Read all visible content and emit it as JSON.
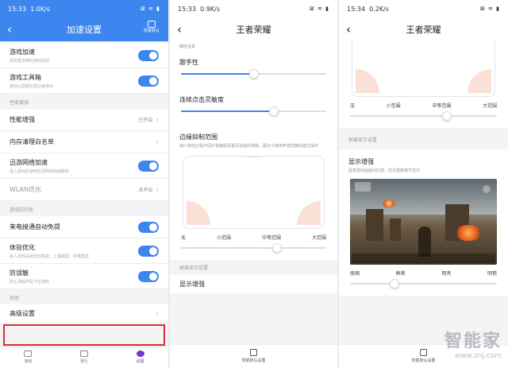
{
  "panel1": {
    "status": {
      "time": "15:33",
      "speed": "1.0K/s",
      "icons": "⊠ ≋ ▮"
    },
    "header": {
      "back": "‹",
      "title": "加速设置",
      "restore_label": "恢复默认"
    },
    "items_top": [
      {
        "title": "游戏加速",
        "sub": "承受更流畅的游戏体验"
      },
      {
        "title": "游戏工具箱",
        "sub": "游戏从屏幕右侧边缘滑出"
      }
    ],
    "section_perf": "性能增强",
    "perf_enhance": {
      "title": "性能增强",
      "value": "已开启"
    },
    "whitelist": {
      "title": "内存清理白名单"
    },
    "network": {
      "title": "迅游网络加速",
      "sub": "进入游戏后使用迅游网络加速服务"
    },
    "wlan": {
      "title": "WLAN优化",
      "value": "未开启"
    },
    "section_nodisturb": "游戏防打扰",
    "auto_reject": {
      "title": "来电接通自动免提"
    },
    "experience": {
      "title": "体验优化",
      "sub": "进入游戏关闭自动亮度、上报截屏、护眼模式"
    },
    "mistouch": {
      "title": "防误触",
      "sub": "防止误操作及下拉通知"
    },
    "section_other": "其他",
    "advanced": {
      "title": "高级设置"
    },
    "nav": {
      "n1": "游戏",
      "n2": "排行",
      "n3": "设置"
    }
  },
  "panel2": {
    "status": {
      "time": "15:33",
      "speed": "0.9K/s",
      "icons": "⊠ ≋ ▮"
    },
    "header": {
      "back": "‹",
      "title": "王者荣耀"
    },
    "caption1": "触控设置",
    "follow": {
      "title": "跟手性",
      "value_pct": 50
    },
    "continuous": {
      "title": "连续点击灵敏度",
      "value_pct": 64
    },
    "edge": {
      "title": "边缘抑制范围",
      "desc": "减少游戏过程中因手掌触碰屏幕而造成的误触，图示为使用声音屏蔽的建议操作"
    },
    "range_labels": [
      "无",
      "小范围",
      "中等范围",
      "大范围"
    ],
    "range_value_pct": 66,
    "caption2": "屏幕显示设置",
    "display": {
      "title": "显示增强"
    },
    "footer": "恢复默认设置"
  },
  "panel3": {
    "status": {
      "time": "15:34",
      "speed": "0.2K/s",
      "icons": "⊠ ≋ ▮"
    },
    "header": {
      "back": "‹",
      "title": "王者荣耀"
    },
    "range_labels": [
      "无",
      "小范围",
      "中等范围",
      "大范围"
    ],
    "range_value_pct": 66,
    "caption": "屏幕显示设置",
    "display": {
      "title": "显示增强",
      "desc": "提高游戏画面对比度，优化图像细节显示"
    },
    "color_labels": [
      "原图",
      "鲜艳",
      "明亮",
      "明艳"
    ],
    "color_value_pct": 30,
    "footer": "恢复默认设置"
  },
  "watermark": {
    "cn": "智能家",
    "url": "www.znj.com"
  },
  "colors": {
    "accent": "#3d86f0",
    "highlight": "#d9312b"
  }
}
